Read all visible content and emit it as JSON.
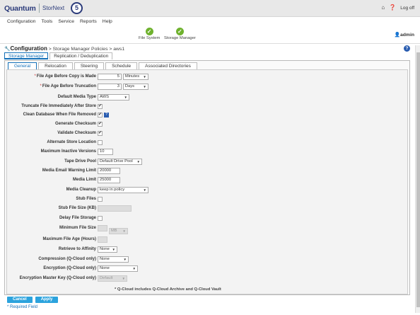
{
  "brand": {
    "name": "Quantum",
    "product": "StorNext",
    "version": "5"
  },
  "top_right": {
    "home_icon": "home-icon",
    "help_icon": "help-icon",
    "logoff": "Log off"
  },
  "menu": [
    "Configuration",
    "Tools",
    "Service",
    "Reports",
    "Help"
  ],
  "status": [
    {
      "label": "File System"
    },
    {
      "label": "Storage Manager"
    }
  ],
  "user": "admin",
  "breadcrumb": {
    "title": "Configuration",
    "path": " > Storage Manager Policies > aws1"
  },
  "tabs_top": [
    "Storage Manager",
    "Replication / Deduplication"
  ],
  "tabs_sub": [
    "General",
    "Relocation",
    "Steering",
    "Schedule",
    "Associated Directories"
  ],
  "fields": {
    "file_age_copy": {
      "label": "File Age Before Copy is Made",
      "value": "5",
      "unit": "Minutes"
    },
    "file_age_trunc": {
      "label": "File Age Before Truncation",
      "value": "3",
      "unit": "Days"
    },
    "media_type": {
      "label": "Default Media Type",
      "value": "AWS"
    },
    "truncate_after_store": {
      "label": "Truncate File Immediately After Store",
      "checked": true
    },
    "clean_db": {
      "label": "Clean Database When File Removed",
      "checked": true
    },
    "gen_checksum": {
      "label": "Generate Checksum",
      "checked": true
    },
    "val_checksum": {
      "label": "Validate Checksum",
      "checked": true
    },
    "alt_store": {
      "label": "Alternate Store Location",
      "checked": false
    },
    "max_versions": {
      "label": "Maximum Inactive Versions",
      "value": "10"
    },
    "tape_pool": {
      "label": "Tape Drive Pool",
      "value": "Default Drive Pool"
    },
    "email_warn": {
      "label": "Media Email Warning Limit",
      "value": "20000"
    },
    "media_limit": {
      "label": "Media Limit",
      "value": "25000"
    },
    "media_cleanup": {
      "label": "Media Cleanup",
      "value": "keep in policy"
    },
    "stub_files": {
      "label": "Stub Files",
      "checked": false
    },
    "stub_size": {
      "label": "Stub File Size (KB)",
      "value": ""
    },
    "delay_storage": {
      "label": "Delay File Storage",
      "checked": false
    },
    "min_size": {
      "label": "Minimum File Size",
      "value": "",
      "unit": "MB"
    },
    "max_age": {
      "label": "Maximum File Age (Hours)",
      "value": ""
    },
    "retrieve_affinity": {
      "label": "Retrieve to Affinity",
      "value": "None"
    },
    "compression": {
      "label": "Compression (Q-Cloud only)",
      "value": "None"
    },
    "encryption": {
      "label": "Encryption (Q-Cloud only)",
      "value": "None"
    },
    "enc_master_key": {
      "label": "Encryption Master Key (Q-Cloud only)",
      "value": "Default"
    }
  },
  "note": "* Q-Cloud includes Q-Cloud Archive and Q-Cloud Vault",
  "buttons": {
    "cancel": "Cancel",
    "apply": "Apply"
  },
  "required_note": "* Required Field",
  "colors": {
    "accent": "#1470b8",
    "button": "#2ca3dd",
    "ok": "#6fb22e",
    "brand": "#2b3b7a"
  }
}
